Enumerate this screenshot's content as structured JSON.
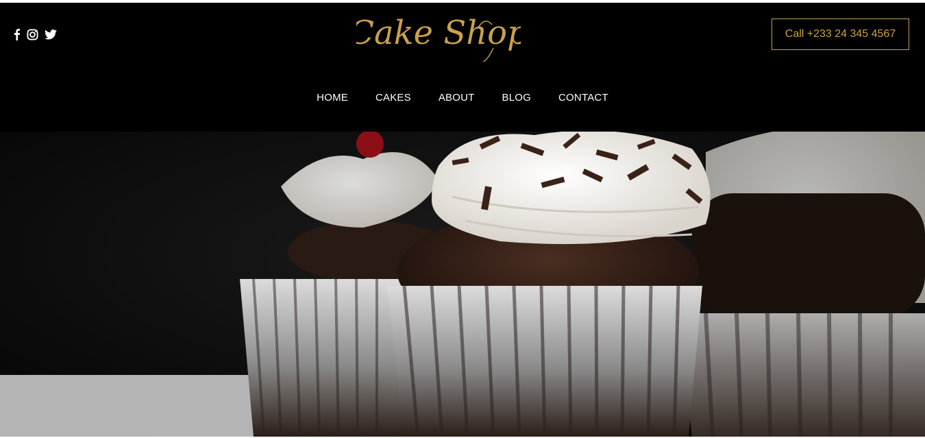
{
  "header": {
    "social": [
      {
        "name": "facebook-icon"
      },
      {
        "name": "instagram-icon"
      },
      {
        "name": "twitter-icon"
      }
    ],
    "logo_text": "Cake Shop",
    "call_label": "Call +233 24 345 4567"
  },
  "nav": {
    "items": [
      {
        "label": "HOME"
      },
      {
        "label": "CAKES"
      },
      {
        "label": "ABOUT"
      },
      {
        "label": "BLOG"
      },
      {
        "label": "CONTACT"
      }
    ]
  },
  "colors": {
    "accent": "#c9a14a",
    "background": "#000000",
    "nav_text": "#ffffff"
  }
}
